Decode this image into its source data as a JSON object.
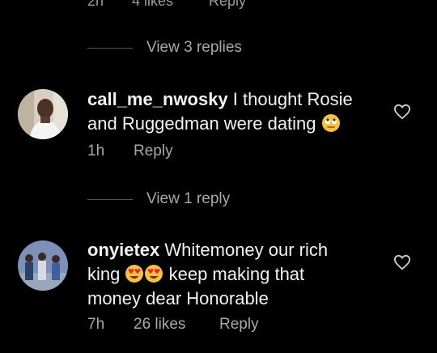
{
  "top_meta": {
    "time": "2h",
    "likes": "4 likes",
    "reply": "Reply"
  },
  "comments": [
    {
      "view_replies": "View 3 replies",
      "username": "call_me_nwosky",
      "text_lines": [
        "I thought Rosie",
        "and Ruggedman were dating"
      ],
      "emoji": "face-with-rolling-eyes",
      "time": "1h",
      "likes": "",
      "reply": "Reply"
    },
    {
      "view_replies": "View 1 reply",
      "username": "onyietex",
      "text_lines": [
        "Whitemoney our rich",
        "king",
        "keep making that",
        "money dear Honorable"
      ],
      "emoji": "smiling-face-with-heart-eyes",
      "time": "7h",
      "likes": "26 likes",
      "reply": "Reply"
    }
  ],
  "colors": {
    "background": "#000000",
    "text": "#f2f2f2",
    "muted": "#a8a8a8",
    "emoji": "#f7c23a"
  }
}
